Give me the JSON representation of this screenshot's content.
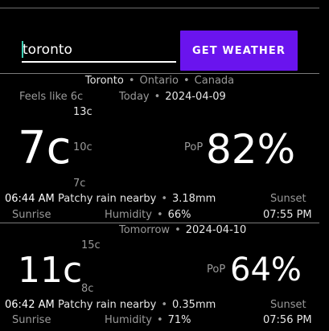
{
  "search": {
    "value": "toronto",
    "button_label": "GET WEATHER"
  },
  "location": {
    "city": "Toronto",
    "region": "Ontario",
    "country": "Canada"
  },
  "current": {
    "feels_like": "Feels like 6c"
  },
  "days": [
    {
      "day_label": "Today",
      "date": "2024-04-09",
      "high": "13c",
      "temp": "7c",
      "mid": "10c",
      "low": "7c",
      "pop_label": "PoP",
      "pop": "82%",
      "sunrise_time": "06:44 AM",
      "sunrise_label": "Sunrise",
      "condition": "Patchy rain nearby",
      "precip": "3.18mm",
      "humidity_label": "Humidity",
      "humidity": "66%",
      "sunset_label": "Sunset",
      "sunset_time": "07:55 PM"
    },
    {
      "day_label": "Tomorrow",
      "date": "2024-04-10",
      "high": "15c",
      "temp": "11c",
      "low": "8c",
      "pop_label": "PoP",
      "pop": "64%",
      "sunrise_time": "06:42 AM",
      "sunrise_label": "Sunrise",
      "condition": "Patchy rain nearby",
      "precip": "0.35mm",
      "humidity_label": "Humidity",
      "humidity": "71%",
      "sunset_label": "Sunset",
      "sunset_time": "07:56 PM"
    }
  ],
  "colors": {
    "button": "#6a14ee",
    "caret": "#3fd0b5",
    "background": "#000000"
  }
}
